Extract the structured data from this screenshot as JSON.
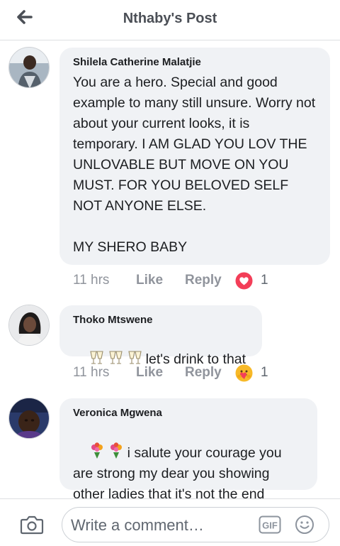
{
  "header": {
    "title": "Nthaby's Post",
    "back_icon": "arrow-left-icon"
  },
  "comments": [
    {
      "author": "Shilela Catherine Malatjie",
      "text": "You are a hero. Special and good example to many still unsure. Worry not about your current looks, it is temporary. I AM GLAD YOU LOV THE UNLOVABLE BUT MOVE ON YOU MUST. FOR YOU BELOVED SELF NOT ANYONE ELSE.\n\nMY SHERO BABY",
      "time": "11 hrs",
      "like_label": "Like",
      "reply_label": "Reply",
      "reaction": "love-reaction-icon",
      "reaction_count": "1"
    },
    {
      "author": "Thoko Mtswene",
      "emoji": "champagne-glasses-icon",
      "text": "let's drink to that",
      "time": "11 hrs",
      "like_label": "Like",
      "reply_label": "Reply",
      "reaction": "care-reaction-icon",
      "reaction_count": "1"
    },
    {
      "author": "Veronica Mgwena",
      "emoji": "bouquet-icon",
      "text": "i salute your courage you are strong my dear you showing other ladies that it's not the end"
    }
  ],
  "composer": {
    "placeholder": "Write a comment…",
    "camera_icon": "camera-icon",
    "gif_label": "GIF",
    "emoji_icon": "smiley-icon"
  },
  "colors": {
    "bubble": "#f0f2f5",
    "meta_text": "#90949c",
    "love_red": "#f33e58",
    "care_yellow": "#f7b928"
  }
}
